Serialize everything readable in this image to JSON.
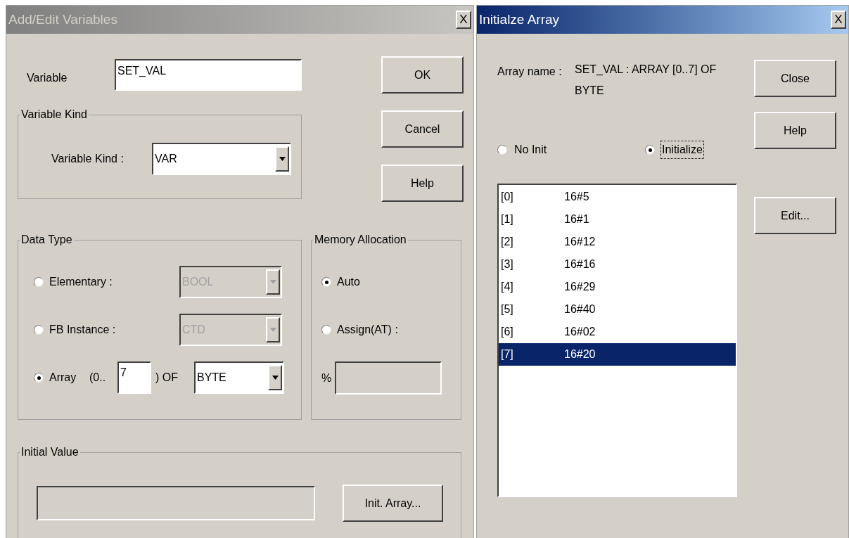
{
  "add_edit_variables": {
    "title": "Add/Edit Variables",
    "active": false,
    "close": "X",
    "variable": {
      "label": "Variable",
      "value": "SET_VAL"
    },
    "variable_kind": {
      "group": "Variable Kind",
      "label": "Variable Kind :",
      "value": "VAR"
    },
    "buttons": [
      "OK",
      "Cancel",
      "Help"
    ],
    "data_type": {
      "group": "Data Type",
      "options": [
        {
          "kind": "select",
          "label": "Elementary :",
          "selected": false,
          "value": "BOOL",
          "disabled": true
        },
        {
          "kind": "select",
          "label": "FB Instance :",
          "selected": false,
          "value": "CTD",
          "disabled": true
        },
        {
          "kind": "array",
          "label": "Array",
          "selected": true,
          "range_start": "(0..",
          "upper": "7",
          "range_end": ") OF",
          "value": "BYTE",
          "disabled": false
        }
      ]
    },
    "memory_allocation": {
      "group": "Memory Allocation",
      "options": [
        {
          "label": "Auto",
          "selected": true
        },
        {
          "label": "Assign(AT) :",
          "selected": false
        }
      ],
      "prefix": "%"
    },
    "initial_value": {
      "group": "Initial Value",
      "button": "Init. Array..."
    }
  },
  "initialize_array": {
    "title": "Initialze Array",
    "active": true,
    "close": "X",
    "array_name_label": "Array name :",
    "array_name": "SET_VAL : ARRAY [0..7] OF BYTE",
    "modes": [
      {
        "label": "No Init",
        "selected": false,
        "focused": false
      },
      {
        "label": "Initialize",
        "selected": true,
        "focused": true
      }
    ],
    "elements": [
      {
        "index": "[0]",
        "value": "16#5",
        "selected": false
      },
      {
        "index": "[1]",
        "value": "16#1",
        "selected": false
      },
      {
        "index": "[2]",
        "value": "16#12",
        "selected": false
      },
      {
        "index": "[3]",
        "value": "16#16",
        "selected": false
      },
      {
        "index": "[4]",
        "value": "16#29",
        "selected": false
      },
      {
        "index": "[5]",
        "value": "16#40",
        "selected": false
      },
      {
        "index": "[6]",
        "value": "16#02",
        "selected": false
      },
      {
        "index": "[7]",
        "value": "16#20",
        "selected": true
      }
    ],
    "buttons": [
      "Close",
      "Help",
      "Edit..."
    ]
  }
}
